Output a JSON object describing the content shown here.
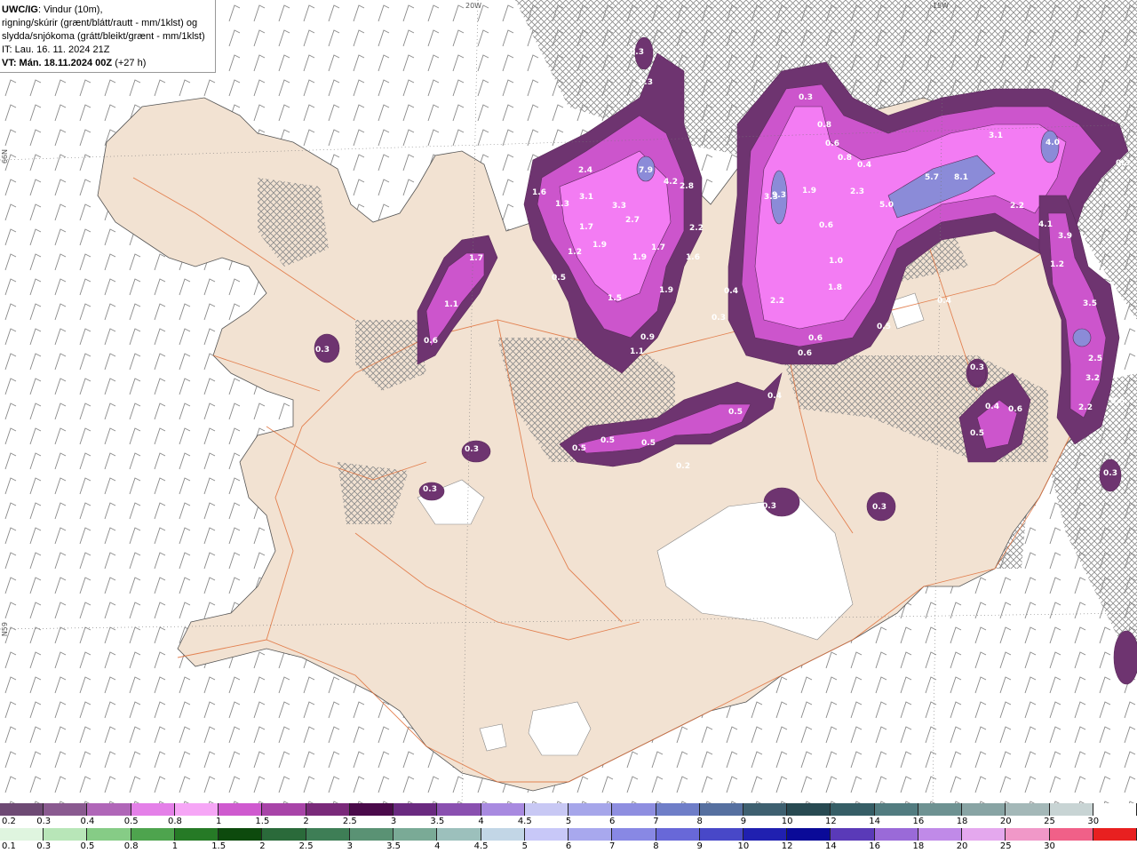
{
  "header": {
    "model": "UWC/IG",
    "line1_rest": ": Vindur (10m),",
    "line2": "rigning/skúrir (grænt/blátt/rautt - mm/1klst) og",
    "line3": "slydda/snjókoma (grátt/bleikt/grænt - mm/1klst)",
    "it_line": "IT: Lau. 16. 11. 2024 21Z",
    "vt_bold": "VT: Mán. 18.11.2024 00Z",
    "vt_rest": " (+27 h)"
  },
  "grid_labels": {
    "lon_20w": "20W",
    "lon_15w": "15W",
    "lat_66n": "66N",
    "lat_65n": "N59"
  },
  "colors": {
    "land": "#f2e2d2",
    "sea": "#ffffff",
    "roads": "#e0703a",
    "cloud_hatch": "#8a8a8a",
    "precip_light": "#f37cf3",
    "precip_mid": "#cc55cc",
    "precip_dark": "#6e3470",
    "precip_heavy": "#8b8bd8"
  },
  "precip_labels": [
    "0.3",
    "0.3",
    "1.6",
    "2.4",
    "3.1",
    "1.3",
    "3.3",
    "7.9",
    "4.2",
    "2.8",
    "2.7",
    "1.7",
    "1.9",
    "2.2",
    "1.2",
    "1.9",
    "1.7",
    "1.6",
    "0.5",
    "1.5",
    "1.9",
    "0.9",
    "1.1",
    "1.7",
    "1.1",
    "0.6",
    "0.3",
    "3.3",
    "0.8",
    "0.6",
    "0.8",
    "0.4",
    "1.9",
    "9.3",
    "2.3",
    "0.6",
    "5.0",
    "5.7",
    "8.1",
    "3.1",
    "4.0",
    "2.2",
    "4.1",
    "3.9",
    "1.2",
    "1.0",
    "1.8",
    "2.2",
    "0.4",
    "0.3",
    "0.4",
    "0.6",
    "0.6",
    "0.5",
    "0.4",
    "0.5",
    "0.3",
    "0.4",
    "3.5",
    "2.5",
    "3.2",
    "2.2",
    "0.6",
    "0.6",
    "0.5",
    "0.5",
    "0.5",
    "0.5",
    "0.3",
    "0.3",
    "0.2",
    "0.3",
    "0.3",
    "0.3",
    "0.3",
    "0.3"
  ],
  "legend_snow": {
    "labels": [
      "0.2",
      "0.3",
      "0.4",
      "0.5",
      "0.8",
      "1",
      "1.5",
      "2",
      "2.5",
      "3",
      "3.5",
      "4",
      "4.5",
      "5",
      "6",
      "7",
      "8",
      "9",
      "10",
      "12",
      "14",
      "16",
      "18",
      "20",
      "25",
      "30"
    ],
    "colors": [
      "#6e4a74",
      "#8a5a90",
      "#b066b8",
      "#e480e8",
      "#f6a6f6",
      "#cf5acf",
      "#a844a8",
      "#7a2a7a",
      "#4a0a4a",
      "#6a2a80",
      "#8a50b0",
      "#a88ae0",
      "#c8c8f4",
      "#a6a6ea",
      "#8e8ee0",
      "#6f7ec8",
      "#5670a0",
      "#3e6070",
      "#284a52",
      "#365e66",
      "#527c80",
      "#6e9292",
      "#88a4a4",
      "#a4b8b8",
      "#c8d4d4",
      "#ffffff"
    ]
  },
  "legend_rain": {
    "labels": [
      "0.1",
      "0.3",
      "0.5",
      "0.8",
      "1",
      "1.5",
      "2",
      "2.5",
      "3",
      "3.5",
      "4",
      "4.5",
      "5",
      "6",
      "7",
      "8",
      "9",
      "10",
      "12",
      "14",
      "16",
      "18",
      "20",
      "25",
      "30"
    ],
    "colors": [
      "#dff5df",
      "#b8e6b8",
      "#86cc86",
      "#4ea44e",
      "#267a26",
      "#0d4a0d",
      "#2a6a3a",
      "#3e7e56",
      "#5a9274",
      "#7aaa96",
      "#9cc0bc",
      "#c2d6e6",
      "#c8c8f8",
      "#a8a8ee",
      "#8888e4",
      "#6868d8",
      "#4848c8",
      "#2020b0",
      "#0a0a98",
      "#5a3ab8",
      "#9a6ad8",
      "#c08ae8",
      "#e4a8ee",
      "#f098c8",
      "#f06088",
      "#e82020"
    ]
  }
}
